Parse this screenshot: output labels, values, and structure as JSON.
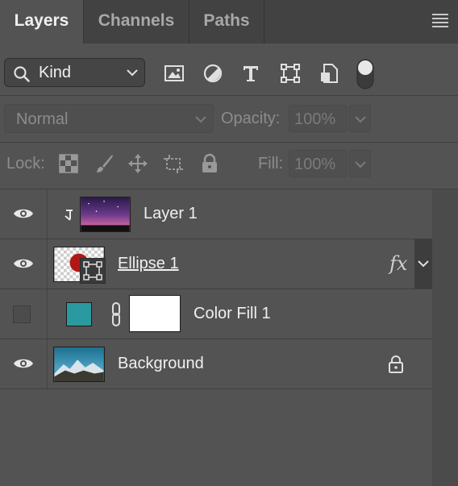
{
  "tabs": [
    {
      "label": "Layers",
      "active": true
    },
    {
      "label": "Channels",
      "active": false
    },
    {
      "label": "Paths",
      "active": false
    }
  ],
  "filter": {
    "kind_label": "Kind",
    "icons": [
      "image-filter-icon",
      "adjustment-filter-icon",
      "type-filter-icon",
      "shape-filter-icon",
      "smart-object-filter-icon",
      "filter-toggle-icon"
    ]
  },
  "blend": {
    "mode": "Normal",
    "opacity_label": "Opacity:",
    "opacity_value": "100%"
  },
  "lock": {
    "label": "Lock:",
    "fill_label": "Fill:",
    "fill_value": "100%",
    "icons": [
      "lock-transparent-pixels-icon",
      "lock-image-pixels-icon",
      "lock-position-icon",
      "lock-artboard-icon",
      "lock-all-icon"
    ]
  },
  "layers": [
    {
      "name": "Layer 1",
      "visible": true,
      "clipped": true,
      "thumb": "night-sky"
    },
    {
      "name": "Ellipse 1",
      "visible": true,
      "fx": "fx",
      "thumb": "ellipse-shape"
    },
    {
      "name": "Color Fill 1",
      "visible": false,
      "thumb": "color-fill",
      "fill_color": "#2a9aa0"
    },
    {
      "name": "Background",
      "visible": true,
      "locked": true,
      "thumb": "mountain"
    }
  ]
}
